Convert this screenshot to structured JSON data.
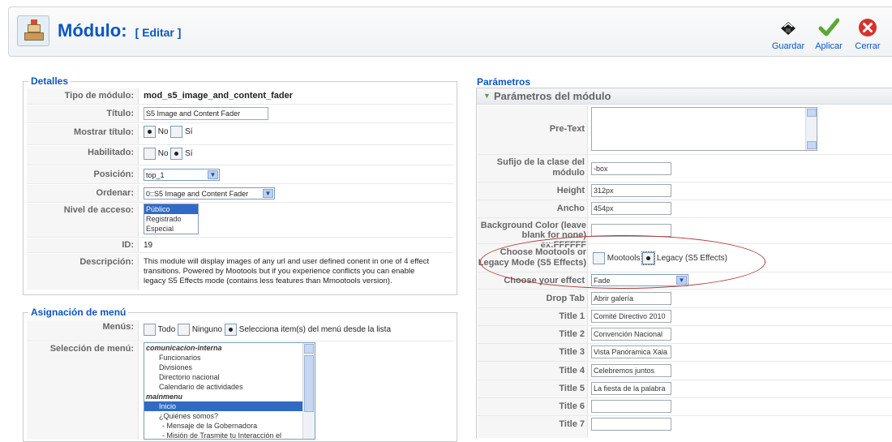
{
  "header": {
    "title": "Módulo:",
    "subtitle": "[ Editar ]",
    "buttons": {
      "save": "Guardar",
      "apply": "Aplicar",
      "close": "Cerrar"
    }
  },
  "details": {
    "legend": "Detalles",
    "type_label": "Tipo de módulo:",
    "type_value": "mod_s5_image_and_content_fader",
    "title_label": "Título:",
    "title_value": "S5 Image and Content Fader",
    "show_title_label": "Mostrar título:",
    "show_title_no": "No",
    "show_title_yes": "Sí",
    "enabled_label": "Habilitado:",
    "enabled_no": "No",
    "enabled_yes": "Sí",
    "position_label": "Posición:",
    "position_value": "top_1",
    "order_label": "Ordenar:",
    "order_value": "0::S5 Image and Content Fader",
    "access_label": "Nivel de acceso:",
    "access_options": [
      "Público",
      "Registrado",
      "Especial"
    ],
    "id_label": "ID:",
    "id_value": "19",
    "desc_label": "Descripción:",
    "desc_lines": [
      "This module will display images of any url and user defined conent in one of 4 effect",
      "transitions. Powered by Mootools but if you experience conflicts you can enable",
      "legacy S5 Effects mode (contains less features than Mmootools version)."
    ]
  },
  "menu": {
    "legend": "Asignación de menú",
    "menus_label": "Menús:",
    "opt_all": "Todo",
    "opt_none": "Ninguno",
    "opt_select": "Selecciona item(s) del menú desde la lista",
    "selection_label": "Selección de menú:",
    "items": [
      "comunicacion-interna",
      "Funcionarios",
      "Divisiones",
      "Directorio nacional",
      "Calendario de actividades",
      "mainmenu",
      "Inicio",
      "¿Quiénes somos?",
      "- Mensaje de la Gobernadora",
      "- Misión de Trasmite tu Interacción el"
    ]
  },
  "params": {
    "legend": "Parámetros",
    "section": "Parámetros del módulo",
    "pretext_label": "Pre-Text",
    "suffix_label_1": "Sufijo de la clase del",
    "suffix_label_2": "módulo",
    "suffix_value": "-box",
    "height_label": "Height",
    "height_value": "312px",
    "width_label": "Ancho",
    "width_value": "454px",
    "bg_label_1": "Background Color (leave",
    "bg_label_2": "blank for none) ex:FFFFFF",
    "mode_label_1": "Choose Mootools or",
    "mode_label_2": "Legacy Mode (S5 Effects)",
    "mode_mootools": "Mootools",
    "mode_legacy": "Legacy (S5 Effects)",
    "effect_label": "Choose your effect",
    "effect_value": "Fade",
    "droptab_label": "Drop Tab",
    "droptab_value": "Abrir galería",
    "title1_label": "Title 1",
    "title1_value": "Comité Directivo 2010",
    "title2_label": "Title 2",
    "title2_value": "Convención Nacional",
    "title3_label": "Title 3",
    "title3_value": "Vista Panóramica Xala",
    "title4_label": "Title 4",
    "title4_value": "Celebremos juntos",
    "title5_label": "Title 5",
    "title5_value": "La fiesta de la palabra",
    "title6_label": "Title 6",
    "title7_label": "Title 7"
  }
}
